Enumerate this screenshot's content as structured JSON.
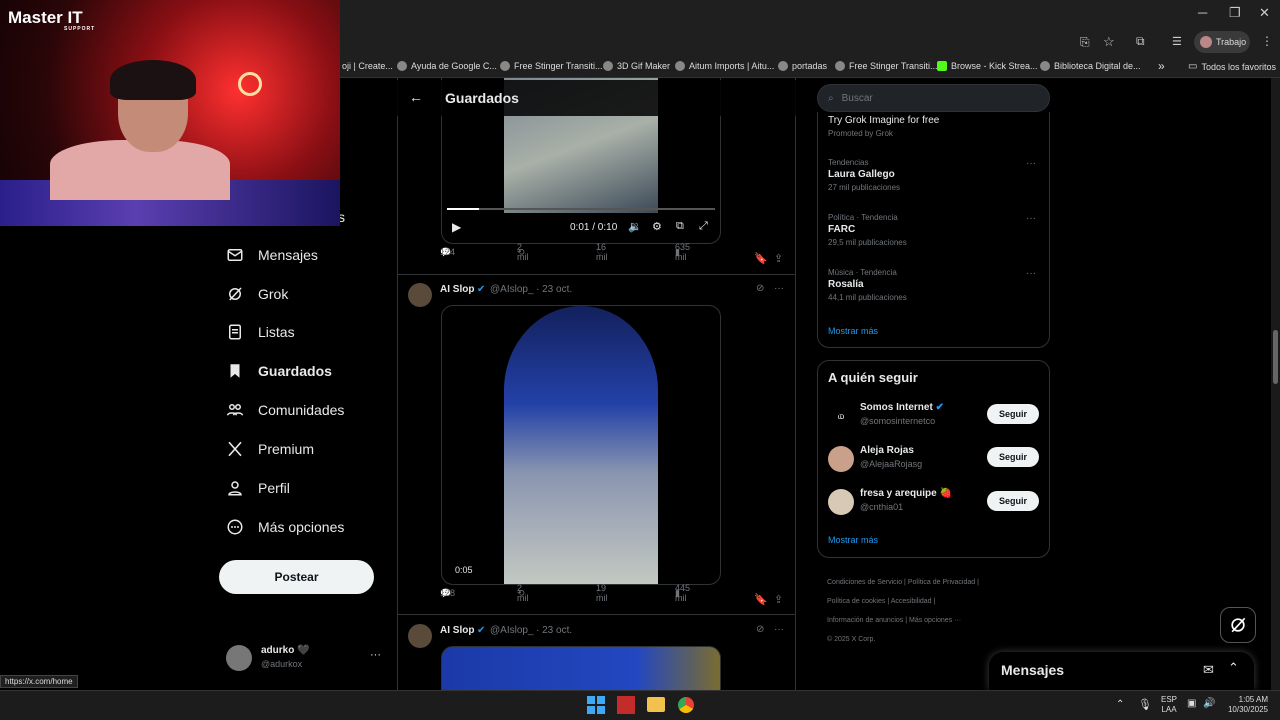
{
  "browser": {
    "profile_label": "Trabajo",
    "bookmarks": [
      "oji | Create...",
      "Ayuda de Google C...",
      "Free Stinger Transiti...",
      "3D Gif Maker",
      "Aitum Imports | Aitu...",
      "portadas",
      "Free Stinger Transiti...",
      "Browse - Kick Strea...",
      "Biblioteca Digital de..."
    ],
    "bookmarks_more": "»",
    "all_favorites": "Todos los favoritos",
    "status_url": "https://x.com/home"
  },
  "overlay": {
    "logo_main": "Master IT",
    "logo_sub": "SUPPORT",
    "nav_fragment": "s"
  },
  "nav": {
    "items": [
      {
        "label": "Mensajes",
        "icon": "mail-icon"
      },
      {
        "label": "Grok",
        "icon": "grok-icon"
      },
      {
        "label": "Listas",
        "icon": "list-icon"
      },
      {
        "label": "Guardados",
        "icon": "bookmark-icon"
      },
      {
        "label": "Comunidades",
        "icon": "communities-icon"
      },
      {
        "label": "Premium",
        "icon": "x-logo-icon"
      },
      {
        "label": "Perfil",
        "icon": "profile-icon"
      },
      {
        "label": "Más opciones",
        "icon": "more-circle-icon"
      }
    ],
    "post_button": "Postear"
  },
  "account": {
    "name": "adurko 🖤",
    "handle": "@adurkox",
    "more": "···"
  },
  "feed": {
    "title": "Guardados",
    "player_time": "0:01 / 0:10",
    "tweets": [
      {
        "replies": "124",
        "retweets": "2 mil",
        "likes": "16 mil",
        "views": "635 mil"
      },
      {
        "author": "AI Slop",
        "handle": "@AIslop_",
        "date": "· 23 oct.",
        "video_time": "0:05",
        "replies": "128",
        "retweets": "2 mil",
        "likes": "19 mil",
        "views": "445 mil"
      },
      {
        "author": "AI Slop",
        "handle": "@AIslop_",
        "date": "· 23 oct."
      }
    ]
  },
  "right": {
    "search_placeholder": "Buscar",
    "promo": "Try Grok Imagine for free",
    "promoted": "Promoted by Grok",
    "trends": [
      {
        "category": "Tendencias",
        "name": "Laura Gallego",
        "count": "27 mil publicaciones"
      },
      {
        "category": "Política · Tendencia",
        "name": "FARC",
        "count": "29,5 mil publicaciones"
      },
      {
        "category": "Música · Tendencia",
        "name": "Rosalía",
        "count": "44,1 mil publicaciones"
      }
    ],
    "show_more": "Mostrar más",
    "who_to_follow_title": "A quién seguir",
    "follow": [
      {
        "name": "Somos Internet",
        "handle": "@somosinternetco",
        "verified": true
      },
      {
        "name": "Aleja Rojas",
        "handle": "@AlejaaRojasg",
        "verified": false
      },
      {
        "name": "fresa y arequipe 🍓",
        "handle": "@cnthia01",
        "verified": false
      }
    ],
    "follow_label": "Seguir",
    "show_more_2": "Mostrar más",
    "footer": {
      "l1": "Condiciones de Servicio",
      "l2": "Política de Privacidad",
      "l3": "Política de cookies",
      "l4": "Accesibilidad",
      "l5": "Información de anuncios",
      "l6": "Más opciones ···",
      "copyright": "© 2025 X Corp."
    },
    "messages_drawer": "Mensajes"
  },
  "taskbar": {
    "lang1": "ESP",
    "lang2": "LAA",
    "time": "1:05 AM",
    "date": "10/30/2025"
  }
}
